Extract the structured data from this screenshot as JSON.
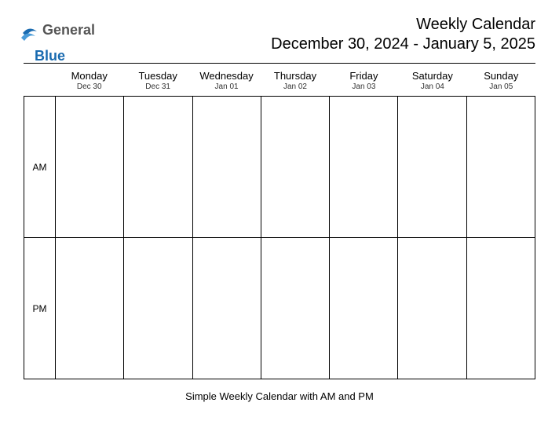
{
  "logo": {
    "text1": "General",
    "text2": "Blue"
  },
  "title": {
    "main": "Weekly Calendar",
    "range": "December 30, 2024 - January 5, 2025"
  },
  "days": [
    {
      "name": "Monday",
      "date": "Dec 30"
    },
    {
      "name": "Tuesday",
      "date": "Dec 31"
    },
    {
      "name": "Wednesday",
      "date": "Jan 01"
    },
    {
      "name": "Thursday",
      "date": "Jan 02"
    },
    {
      "name": "Friday",
      "date": "Jan 03"
    },
    {
      "name": "Saturday",
      "date": "Jan 04"
    },
    {
      "name": "Sunday",
      "date": "Jan 05"
    }
  ],
  "rows": {
    "am": "AM",
    "pm": "PM"
  },
  "footer": "Simple Weekly Calendar with AM and PM"
}
